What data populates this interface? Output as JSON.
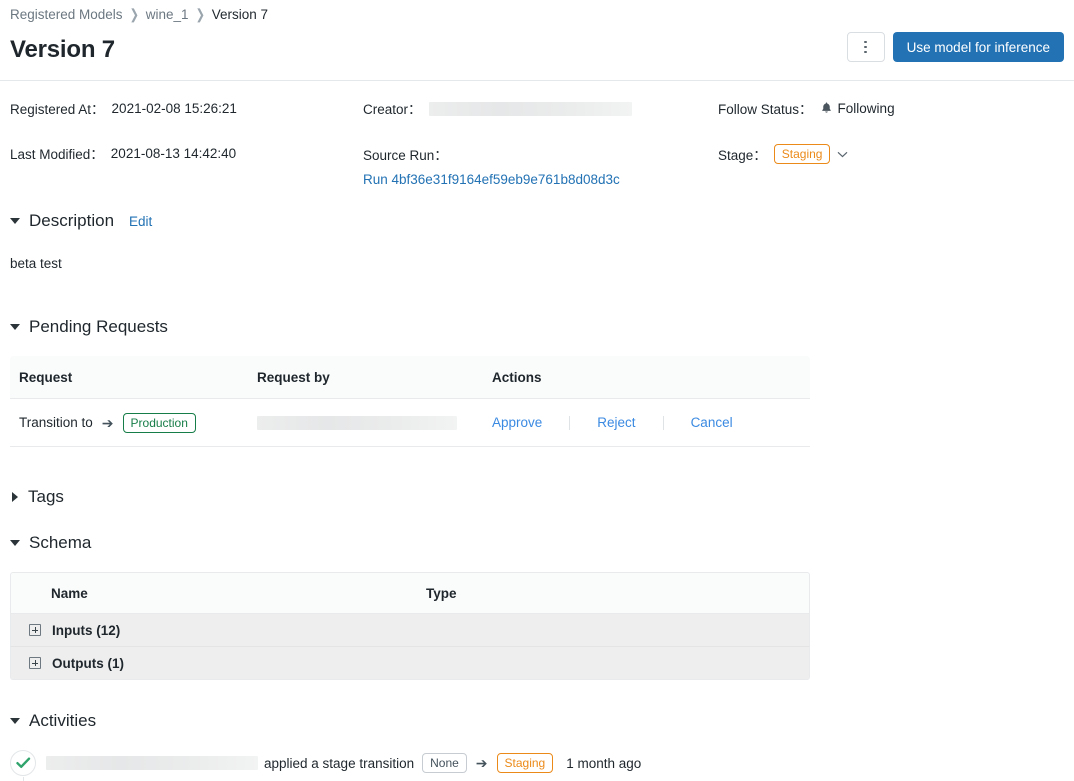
{
  "breadcrumb": {
    "items": [
      {
        "label": "Registered Models",
        "current": false
      },
      {
        "label": "wine_1",
        "current": false
      },
      {
        "label": "Version 7",
        "current": true
      }
    ],
    "separator": "❯"
  },
  "header": {
    "title": "Version 7",
    "kebab_label": "⋮",
    "primary_button": "Use model for inference"
  },
  "meta": {
    "registered_at_label": "Registered At：",
    "registered_at_value": "2021-02-08 15:26:21",
    "last_modified_label": "Last Modified：",
    "last_modified_value": "2021-08-13 14:42:40",
    "creator_label": "Creator：",
    "creator_value": "",
    "source_run_label": "Source Run：",
    "source_run_value": "Run 4bf36e31f9164ef59eb9e761b8d08d3c",
    "follow_status_label": "Follow Status：",
    "follow_status_value": "Following",
    "stage_label": "Stage：",
    "stage_value": "Staging",
    "stage_chevron": "⌄"
  },
  "description": {
    "title": "Description",
    "edit_label": "Edit",
    "body": "beta test"
  },
  "pending_requests": {
    "title": "Pending Requests",
    "columns": [
      "Request",
      "Request by",
      "Actions"
    ],
    "rows": [
      {
        "request_prefix": "Transition to",
        "request_arrow": "➔",
        "request_stage": "Production",
        "requested_by": "",
        "actions": [
          "Approve",
          "Reject",
          "Cancel"
        ]
      }
    ]
  },
  "tags": {
    "title": "Tags"
  },
  "schema": {
    "title": "Schema",
    "columns": [
      "Name",
      "Type"
    ],
    "rows": [
      {
        "name": "Inputs (12)",
        "type": ""
      },
      {
        "name": "Outputs (1)",
        "type": ""
      }
    ]
  },
  "activities": {
    "title": "Activities",
    "entries": [
      {
        "user": "",
        "action": "applied a stage transition",
        "from_stage": "None",
        "arrow": "➔",
        "to_stage": "Staging",
        "time": "1 month ago"
      }
    ]
  },
  "colors": {
    "accent_blue": "#2272b4",
    "link_blue": "#3b8ae2",
    "staging_orange": "#eb8a19",
    "production_green": "#177d48",
    "check_green": "#30a46c"
  }
}
